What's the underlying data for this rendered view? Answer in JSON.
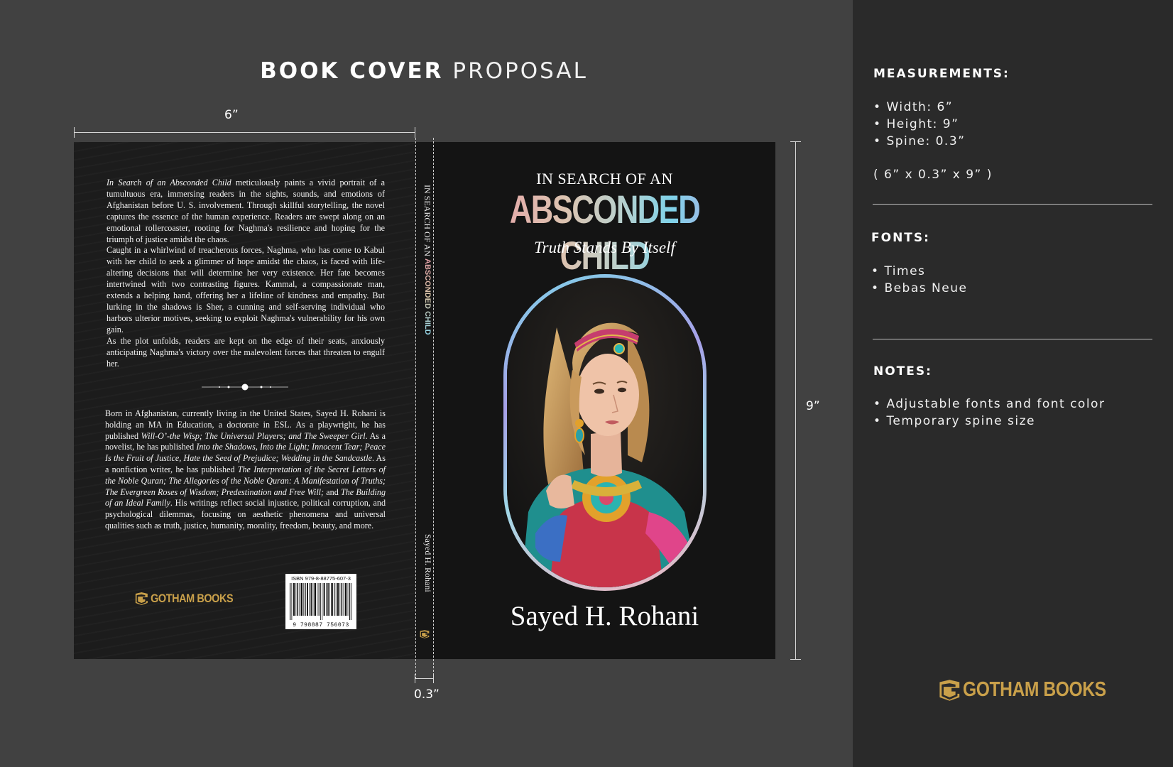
{
  "header": {
    "title_bold": "BOOK COVER",
    "title_light": "PROPOSAL"
  },
  "dimensions": {
    "width": "6”",
    "height": "9”",
    "spine": "0.3”"
  },
  "back_cover": {
    "blurb": [
      {
        "italic": "In Search of an Absconded Child",
        "text": " meticulously paints a vivid portrait of a tumultuous era, immersing readers in the sights, sounds, and emotions of Afghanistan before U. S. involvement.  Through skillful storytelling, the novel captures the essence of the human experience. Readers are swept along on an emotional rollercoaster, rooting for Naghma's resilience and hoping for the triumph of justice amidst the chaos."
      },
      {
        "italic": "",
        "text": "Caught in a whirlwind of treacherous forces, Naghma, who has come to Kabul with her child  to seek a glimmer of hope amidst the chaos,  is faced with life-altering decisions that will determine her very existence. Her fate becomes intertwined with two contrasting figures. Kammal, a compassionate man, extends a helping hand, offering her a lifeline of kindness and empathy. But lurking in the shadows is Sher, a cunning and self-serving individual who harbors ulterior motives, seeking to exploit Naghma's vulnerability for his own gain."
      },
      {
        "italic": "",
        "text": "As the plot unfolds, readers are kept on the edge of their seats, anxiously anticipating Naghma's victory over the malevolent forces that threaten to engulf her."
      }
    ],
    "bio": [
      {
        "t": "Born in Afghanistan, currently living in the United States, Sayed H. Rohani is holding an MA in Education, a doctorate in ESL.  As a playwright, he has published ",
        "i": false
      },
      {
        "t": "Will-O’-the Wisp; The Universal Players; and The Sweeper Girl",
        "i": true
      },
      {
        "t": ". As a novelist, he has published ",
        "i": false
      },
      {
        "t": "Into the Shadows, Into the Light; Innocent Tear; Peace Is the Fruit of Justice, Hate the Seed of Prejudice; Wedding in the Sandcastle",
        "i": true
      },
      {
        "t": ".  As a nonfiction writer, he has published ",
        "i": false
      },
      {
        "t": "The Interpretation of the Secret Letters of the Noble Quran; The Allegories of the Noble Quran: A Manifestation of Truths; The Evergreen Roses of Wisdom; Predestination and Free Will;",
        "i": true
      },
      {
        "t": " and ",
        "i": false
      },
      {
        "t": "The Building of an Ideal Family",
        "i": true
      },
      {
        "t": ". His writings reflect social injustice, political corruption, and psychological dilemmas, focusing on aesthetic phenomena and universal qualities such as truth, justice, humanity, morality, freedom, beauty, and more.",
        "i": false
      }
    ],
    "publisher": "GOTHAM BOOKS",
    "isbn_label": "ISBN 979-8-88775-607-3",
    "barcode_number": "9 798887 756073"
  },
  "spine": {
    "title_plain": "IN SEARCH OF AN ",
    "title_bold": "ABSCONDED CHILD",
    "author": "Sayed H. Rohani"
  },
  "front_cover": {
    "line1": "IN SEARCH OF AN",
    "title": "ABSCONDED CHILD",
    "tagline": "Truth Stands By Itself",
    "author": "Sayed H. Rohani"
  },
  "sidebar": {
    "measurements_heading": "MEASUREMENTS:",
    "measurements": [
      "Width: 6”",
      "Height: 9”",
      "Spine: 0.3”"
    ],
    "measurements_summary": "( 6” x 0.3” x 9” )",
    "fonts_heading": "FONTS:",
    "fonts": [
      "Times",
      "Bebas Neue"
    ],
    "notes_heading": "NOTES:",
    "notes": [
      "Adjustable fonts and font color",
      "Temporary spine size"
    ],
    "publisher": "GOTHAM BOOKS"
  },
  "colors": {
    "page_bg": "#414141",
    "sidebar_bg": "#2a2a2a",
    "gold": "#c9a04a",
    "title_gradient": [
      "#e89ea6",
      "#dcc3b0",
      "#7fd2e8",
      "#b8a6e6"
    ]
  }
}
